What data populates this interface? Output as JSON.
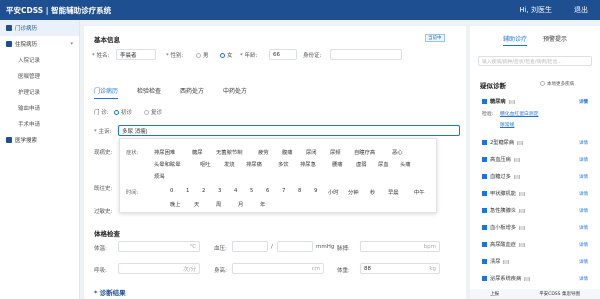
{
  "header": {
    "title": "平安CDSS | 智能辅助诊疗系统",
    "user": "Hi, 刘医生",
    "logout": "退出"
  },
  "sidebar": {
    "groups": [
      {
        "label": "门诊病历",
        "active": true
      },
      {
        "label": "住院病历",
        "active": false
      }
    ],
    "items": [
      "入院记录",
      "医嘱管理",
      "护理记录",
      "输血申请",
      "手术申请"
    ],
    "search_label": "医学搜索"
  },
  "basic": {
    "title": "基本信息",
    "badge": "当前中",
    "name_label": "* 姓名:",
    "name_value": "李晨者",
    "gender_label": "* 性别:",
    "male": "男",
    "female": "女",
    "age_label": "* 年龄:",
    "age_value": "66",
    "id_label": "身份证:"
  },
  "tabs": [
    "门诊病历",
    "检验检查",
    "西药处方",
    "中药处方"
  ],
  "visit": {
    "label": "门 诊:",
    "first": "初诊",
    "return": "复诊"
  },
  "complaint": {
    "label": "* 主诉:",
    "value": "多尿 消瘦|"
  },
  "history_labels": [
    "现病史:",
    "既往史:",
    "过敏史:"
  ],
  "popup": {
    "symptom_label": "症状:",
    "symptoms": [
      "排尿困难",
      "糖尿",
      "无菌脓节制",
      "疲劳",
      "腹痛",
      "尿闭",
      "尿频",
      "自瞳疗高",
      "恶心",
      "头晕和眩晕",
      "呕吐",
      "发烧",
      "排尿痛",
      "多饮",
      "排尿急",
      "腰痛",
      "虚弱",
      "尿血",
      "头痛",
      "烦渴"
    ],
    "time_label": "时间:",
    "times": [
      "0",
      "1",
      "2",
      "3",
      "4",
      "5",
      "6",
      "7",
      "8",
      "9",
      "小时",
      "分钟",
      "秒",
      "早晨",
      "中午",
      "晚上",
      "天",
      "周",
      "月",
      "年"
    ]
  },
  "exam": {
    "title": "体格检查",
    "temp_label": "体温:",
    "temp_unit": "°C",
    "bp_label": "血压:",
    "bp_sep": "/",
    "bp_unit": "mmHg",
    "pulse_label": "脉搏:",
    "pulse_unit": "bpm",
    "resp_label": "呼吸:",
    "resp_unit": "次/分",
    "height_label": "身高:",
    "height_unit": "cm",
    "weight_label": "体重:",
    "weight_value": "88",
    "weight_unit": "kg"
  },
  "result_title": "* 诊断结果",
  "right": {
    "tabs": [
      "辅助诊疗",
      "预警提示"
    ],
    "search_placeholder": "输入疾病/病种/症状/检查/病例/检验...",
    "section_title": "疑似诊断",
    "show_drugs": "本地更多疾病",
    "detail": "详情",
    "diagnoses": [
      "糖尿病",
      "2型糖尿病",
      "高血压病",
      "血糖过多",
      "甲状腺机能",
      "急性胰腺炎",
      "血小板增多",
      "高尿酸血症",
      "溃尿",
      "泌尿系统疾病"
    ],
    "check_label": "检验:",
    "checks": [
      "糖化血红蛋白测定",
      "尿常规"
    ],
    "footer": [
      "上报",
      "平安CDSS 集思导图"
    ]
  }
}
